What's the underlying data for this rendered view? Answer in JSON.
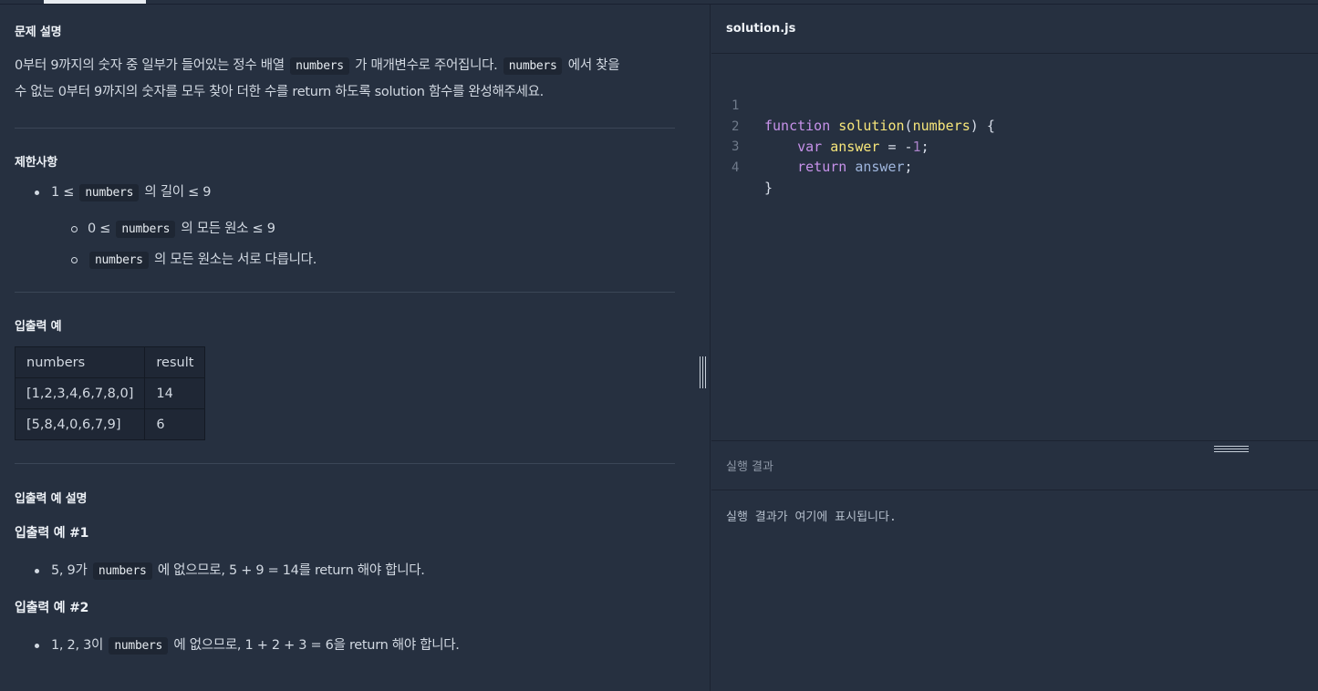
{
  "problem": {
    "description_title": "문제 설명",
    "description_p1": "0부터 9까지의 숫자 중 일부가 들어있는 정수 배열",
    "description_code1": "numbers",
    "description_p2": "가 매개변수로 주어집니다.",
    "description_code2": "numbers",
    "description_p3": "에서 찾을",
    "description_line2": "수 없는 0부터 9까지의 숫자를 모두 찾아 더한 수를 return 하도록 solution 함수를 완성해주세요.",
    "constraints_title": "제한사항",
    "constraint1_pre": "1 ≤",
    "constraint1_code": "numbers",
    "constraint1_post": "의 길이 ≤ 9",
    "constraint2_pre": "0 ≤",
    "constraint2_code": "numbers",
    "constraint2_post": "의 모든 원소 ≤ 9",
    "constraint3_code": "numbers",
    "constraint3_post": "의 모든 원소는 서로 다릅니다.",
    "io_title": "입출력 예",
    "table": {
      "headers": [
        "numbers",
        "result"
      ],
      "rows": [
        [
          "[1,2,3,4,6,7,8,0]",
          "14"
        ],
        [
          "[5,8,4,0,6,7,9]",
          "6"
        ]
      ]
    },
    "explain_title": "입출력 예 설명",
    "ex1_title": "입출력 예 #1",
    "ex1_pre": "5, 9가",
    "ex1_code": "numbers",
    "ex1_post": "에 없으므로, 5 + 9 = 14를 return 해야 합니다.",
    "ex2_title": "입출력 예 #2",
    "ex2_pre": "1, 2, 3이",
    "ex2_code": "numbers",
    "ex2_post": "에 없으므로, 1 + 2 + 3 = 6을 return 해야 합니다."
  },
  "editor": {
    "file_name": "solution.js",
    "line_numbers": [
      "1",
      "2",
      "3",
      "4"
    ],
    "line1": {
      "kw": "function",
      "fn": "solution",
      "open": "(",
      "param": "numbers",
      "close": ") {"
    },
    "line2": {
      "indent": "    ",
      "kw": "var",
      "var": "answer",
      "op": " = -",
      "num": "1",
      "end": ";"
    },
    "line3": {
      "indent": "    ",
      "kw": "return",
      "id": "answer",
      "end": ";"
    },
    "line4": {
      "text": "}"
    }
  },
  "result": {
    "title": "실행 결과",
    "placeholder": "실행 결과가 여기에 표시됩니다."
  },
  "colors": {
    "background": "#263040",
    "keyword": "#c792ea",
    "function": "#f7e67a",
    "number": "#a982c8"
  }
}
